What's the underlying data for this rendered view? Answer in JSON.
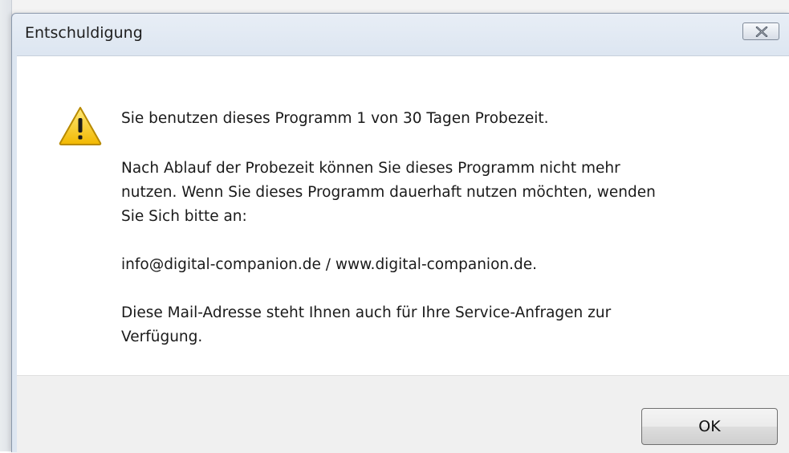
{
  "window": {
    "title": "Entschuldigung"
  },
  "icons": {
    "message_icon": "warning-icon",
    "close_icon": "close-icon"
  },
  "message": {
    "line1": "Sie benutzen dieses Programm 1 von 30 Tagen Probezeit.",
    "paragraph2": [
      "Nach Ablauf der Probezeit können Sie dieses Programm nicht mehr",
      "nutzen. Wenn Sie dieses Programm dauerhaft nutzen möchten, wenden",
      "Sie Sich bitte an:"
    ],
    "contact": "info@digital-companion.de / www.digital-companion.de.",
    "paragraph4": [
      "Diese Mail-Adresse steht Ihnen auch für Ihre Service-Anfragen zur",
      "Verfügung."
    ]
  },
  "buttons": {
    "ok_label": "OK"
  },
  "colors": {
    "content_bg": "#ffffff",
    "footer_bg": "#f0f0f0",
    "warning_yellow": "#f5c400"
  }
}
